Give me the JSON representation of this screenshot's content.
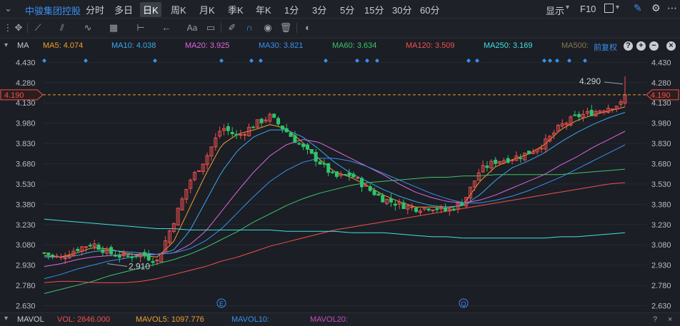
{
  "header": {
    "stock_name": "中骏集团控股",
    "periods": [
      "分时",
      "多日",
      "日K",
      "周K",
      "月K",
      "季K",
      "年K",
      "1分",
      "3分",
      "5分",
      "15分",
      "30分",
      "60分"
    ],
    "active_period": "日K",
    "display_label": "显示",
    "f10_label": "F10"
  },
  "toolbar": {
    "icons": [
      "crosshair-icon",
      "line-tool-icon",
      "channel-tool-icon",
      "wave-tool-icon",
      "measure-tool-icon",
      "range-tool-icon",
      "arrow-tool-icon",
      "text-tool-icon",
      "comment-tool-icon",
      "eraser-icon",
      "magnet-icon",
      "eye-icon",
      "trash-icon",
      "toggle-icon"
    ],
    "text_tool_label": "Aa"
  },
  "ma_bar": {
    "indicator": "MA",
    "items": [
      {
        "label": "MA5: 4.074",
        "color": "#f0a030"
      },
      {
        "label": "MA10: 4.038",
        "color": "#3aa8f0"
      },
      {
        "label": "MA20: 3.925",
        "color": "#e066e0"
      },
      {
        "label": "MA30: 3.821",
        "color": "#3a8ff0"
      },
      {
        "label": "MA60: 3.634",
        "color": "#3ec46d"
      },
      {
        "label": "MA120: 3.509",
        "color": "#f05050"
      },
      {
        "label": "MA250: 3.169",
        "color": "#40e0e0"
      },
      {
        "label": "MA500:",
        "color": "#8a7a50"
      }
    ],
    "adjust_label": "前复权"
  },
  "chart_data": {
    "type": "candlestick",
    "y_ticks": [
      "4.430",
      "4.280",
      "4.130",
      "3.980",
      "3.830",
      "3.680",
      "3.530",
      "3.380",
      "3.230",
      "3.080",
      "2.930",
      "2.780",
      "2.630"
    ],
    "ylim": [
      2.58,
      4.49
    ],
    "current_price": "4.190",
    "high_label": "4.290",
    "low_label": "2.910",
    "up_color": "#f05050",
    "down_color": "#2ec46d",
    "event_markers": [
      "E",
      "Q"
    ],
    "anchors": [
      3.02,
      2.98,
      3.05,
      3.09,
      3.02,
      2.99,
      3.01,
      2.96,
      3.25,
      3.55,
      3.72,
      3.95,
      3.88,
      3.97,
      4.03,
      3.92,
      3.8,
      3.7,
      3.58,
      3.6,
      3.5,
      3.42,
      3.38,
      3.35,
      3.36,
      3.33,
      3.4,
      3.63,
      3.7,
      3.72,
      3.76,
      3.83,
      3.96,
      4.03,
      4.06,
      4.1,
      4.13
    ],
    "ma_lines": [
      {
        "name": "MA5",
        "color": "#f0a030",
        "values": [
          3.0,
          2.99,
          3.02,
          3.06,
          3.05,
          3.02,
          3.0,
          2.99,
          3.1,
          3.35,
          3.6,
          3.82,
          3.9,
          3.93,
          3.97,
          3.94,
          3.84,
          3.72,
          3.62,
          3.58,
          3.52,
          3.45,
          3.4,
          3.36,
          3.36,
          3.35,
          3.38,
          3.55,
          3.66,
          3.71,
          3.75,
          3.82,
          3.93,
          4.0,
          4.04,
          4.07,
          4.1
        ]
      },
      {
        "name": "MA10",
        "color": "#3aa8f0",
        "values": [
          2.99,
          2.99,
          3.0,
          3.03,
          3.04,
          3.03,
          3.02,
          3.01,
          3.04,
          3.18,
          3.4,
          3.62,
          3.78,
          3.88,
          3.93,
          3.93,
          3.88,
          3.79,
          3.69,
          3.61,
          3.55,
          3.49,
          3.44,
          3.4,
          3.37,
          3.36,
          3.37,
          3.45,
          3.56,
          3.65,
          3.7,
          3.76,
          3.84,
          3.91,
          3.97,
          4.02,
          4.06
        ]
      },
      {
        "name": "MA20",
        "color": "#e066e0",
        "values": [
          2.92,
          2.94,
          2.97,
          2.99,
          3.0,
          3.01,
          3.01,
          3.01,
          3.02,
          3.08,
          3.18,
          3.33,
          3.48,
          3.62,
          3.74,
          3.82,
          3.86,
          3.84,
          3.78,
          3.72,
          3.66,
          3.6,
          3.53,
          3.47,
          3.43,
          3.4,
          3.39,
          3.41,
          3.45,
          3.5,
          3.55,
          3.6,
          3.67,
          3.73,
          3.8,
          3.86,
          3.92
        ]
      },
      {
        "name": "MA30",
        "color": "#3a8ff0",
        "values": [
          2.83,
          2.86,
          2.9,
          2.93,
          2.96,
          2.98,
          3.0,
          3.01,
          3.02,
          3.05,
          3.11,
          3.2,
          3.32,
          3.44,
          3.55,
          3.63,
          3.69,
          3.72,
          3.72,
          3.7,
          3.66,
          3.61,
          3.56,
          3.51,
          3.46,
          3.42,
          3.39,
          3.39,
          3.41,
          3.44,
          3.48,
          3.53,
          3.58,
          3.64,
          3.7,
          3.76,
          3.82
        ]
      },
      {
        "name": "MA60",
        "color": "#3ec46d",
        "values": [
          2.72,
          2.75,
          2.78,
          2.81,
          2.85,
          2.88,
          2.91,
          2.94,
          2.97,
          3.01,
          3.06,
          3.12,
          3.18,
          3.25,
          3.31,
          3.37,
          3.42,
          3.46,
          3.49,
          3.52,
          3.54,
          3.55,
          3.56,
          3.57,
          3.58,
          3.58,
          3.59,
          3.59,
          3.6,
          3.6,
          3.6,
          3.6,
          3.6,
          3.61,
          3.62,
          3.63,
          3.64
        ]
      },
      {
        "name": "MA120",
        "color": "#f05050",
        "values": [
          2.8,
          2.81,
          2.81,
          2.8,
          2.8,
          2.8,
          2.81,
          2.83,
          2.86,
          2.89,
          2.92,
          2.96,
          2.99,
          3.03,
          3.07,
          3.1,
          3.13,
          3.16,
          3.19,
          3.21,
          3.23,
          3.25,
          3.27,
          3.29,
          3.31,
          3.33,
          3.35,
          3.37,
          3.39,
          3.41,
          3.43,
          3.45,
          3.47,
          3.49,
          3.51,
          3.53,
          3.54
        ]
      },
      {
        "name": "MA250",
        "color": "#40e0e0",
        "values": [
          3.27,
          3.26,
          3.25,
          3.24,
          3.23,
          3.22,
          3.21,
          3.2,
          3.2,
          3.19,
          3.19,
          3.19,
          3.19,
          3.19,
          3.19,
          3.18,
          3.18,
          3.18,
          3.18,
          3.17,
          3.17,
          3.17,
          3.16,
          3.15,
          3.14,
          3.14,
          3.13,
          3.13,
          3.13,
          3.13,
          3.13,
          3.13,
          3.14,
          3.14,
          3.15,
          3.16,
          3.17
        ]
      }
    ]
  },
  "vol_bar": {
    "label": "MAVOL",
    "items": [
      {
        "label": "VOL: 2646.000",
        "color": "#f05050"
      },
      {
        "label": "MAVOL5: 1097.776",
        "color": "#f0a030"
      },
      {
        "label": "MAVOL10:",
        "color": "#3a8ff0"
      },
      {
        "label": "MAVOL20:",
        "color": "#c050c0"
      }
    ]
  }
}
